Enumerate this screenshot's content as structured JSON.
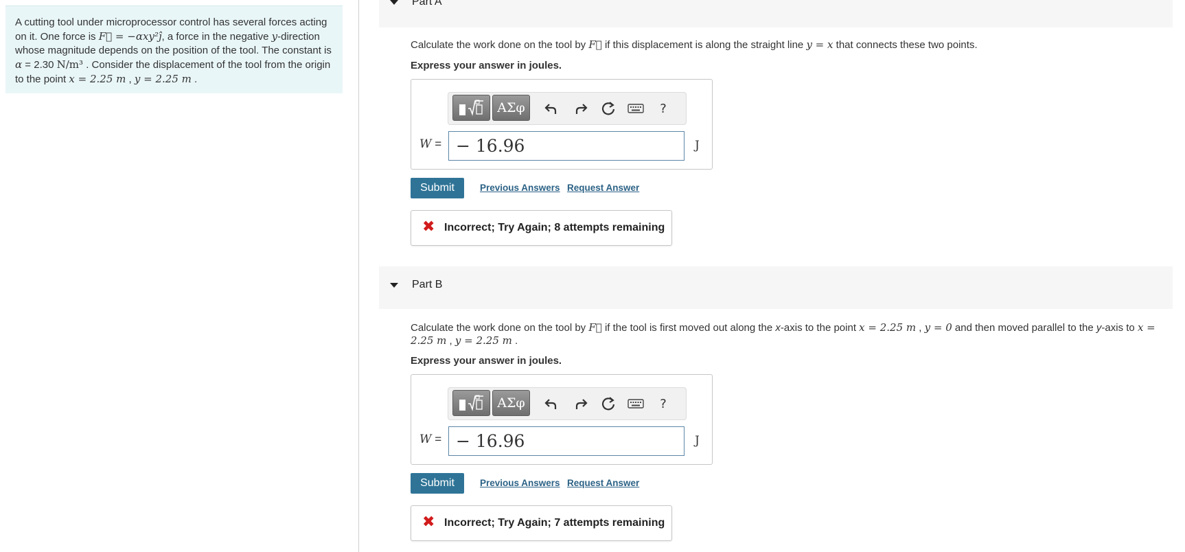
{
  "problem": {
    "text_1": "A cutting tool under microprocessor control has several forces acting on it. One force is",
    "force_expr": "F⃗ = −αxy²ĵ",
    "text_2": ", a force in the negative",
    "y_var": "y",
    "text_3": "-direction whose magnitude depends on the position of the tool. The constant is",
    "alpha_sym": "α",
    "alpha_value": " = 2.30",
    "units": "N/m³",
    "text_4": ". Consider the displacement of the tool from the origin to the point",
    "point_x": "x = 2.25 m",
    "sep": " , ",
    "point_y": "y = 2.25 m",
    "end": " ."
  },
  "parts": [
    {
      "title": "Part A",
      "question_a": "Calculate the work done on the tool by",
      "question_vec": "F⃗",
      "question_b": "if this displacement is along the straight line",
      "question_line": "y = x",
      "question_c": "that connects these two points.",
      "express": "Express your answer in joules.",
      "variable": "W",
      "equals": "=",
      "answer_value": "− 16.96",
      "unit": "J",
      "submit_label": "Submit",
      "previous_answers_label": "Previous Answers",
      "request_answer_label": "Request Answer",
      "feedback_icon": "✖",
      "feedback": "Incorrect; Try Again; 8 attempts remaining"
    },
    {
      "title": "Part B",
      "question_a": "Calculate the work done on the tool by",
      "question_vec": "F⃗",
      "question_b": "if the tool is first moved out along the",
      "question_axis_x": "x",
      "question_c": "-axis to the point",
      "question_p1x": "x = 2.25 m",
      "question_sep1": " , ",
      "question_p1y": "y = 0",
      "question_d": " and then moved parallel to the",
      "question_axis_y": "y",
      "question_e": "-axis to",
      "question_p2x": "x = 2.25 m",
      "question_sep2": " , ",
      "question_p2y": "y = 2.25 m",
      "question_end": " .",
      "express": "Express your answer in joules.",
      "variable": "W",
      "equals": "=",
      "answer_value": "− 16.96",
      "unit": "J",
      "submit_label": "Submit",
      "previous_answers_label": "Previous Answers",
      "request_answer_label": "Request Answer",
      "feedback_icon": "✖",
      "feedback": "Incorrect; Try Again; 7 attempts remaining"
    }
  ],
  "toolbar": {
    "templates_icon": "templates-icon",
    "symbols_label": "ΑΣφ",
    "undo_icon": "undo-icon",
    "redo_icon": "redo-icon",
    "reset_icon": "reset-icon",
    "keyboard_icon": "keyboard-icon",
    "help_label": "?"
  },
  "colors": {
    "problem_bg": "#e9f6f8",
    "submit_bg": "#2f7497",
    "link": "#2c6286",
    "error": "#d21b1b"
  }
}
